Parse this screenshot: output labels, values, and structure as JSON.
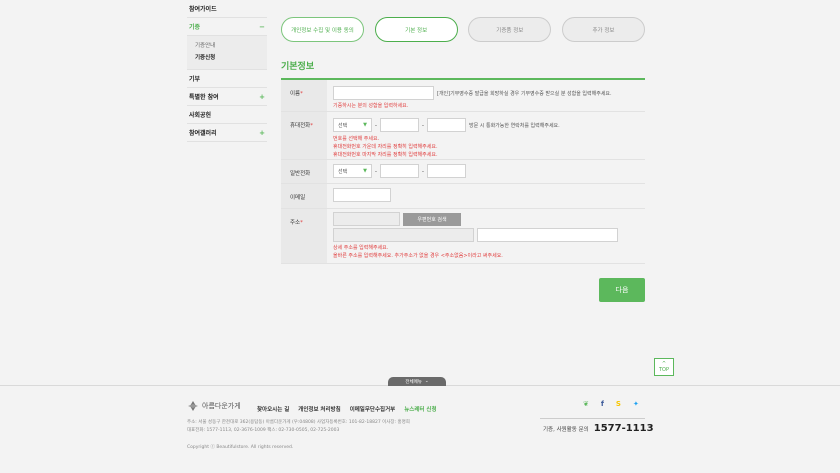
{
  "sidebar": {
    "items": [
      {
        "label": "참여가이드",
        "marker": ""
      },
      {
        "label": "기증",
        "marker": "−"
      },
      {
        "label": "기부",
        "marker": ""
      },
      {
        "label": "특별한 참여",
        "marker": "+"
      },
      {
        "label": "사회공헌",
        "marker": ""
      },
      {
        "label": "참여갤러리",
        "marker": "+"
      }
    ],
    "sub": [
      "기증안내",
      "기증신청"
    ]
  },
  "steps": [
    "개인정보 수집 및 이용 동의",
    "기본 정보",
    "기증품 정보",
    "추가 정보"
  ],
  "section_title": "기본정보",
  "form": {
    "name_label": "이름",
    "req": "*",
    "name_hint": "[개인]기부영수증 발급을 희망하실 경우 기부영수증 받으실 분 성함을 입력해주세요.",
    "name_error": "기증하시는 분의 성함을 입력하세요.",
    "mobile_label": "휴대전화",
    "select_default": "선택",
    "dash": "-",
    "mobile_hint": "방문 시 통화가능한 연락처를 입력해주세요.",
    "mobile_errors": [
      "번호를 선택해 주세요.",
      "휴대전화번호 가운데 자리를 정확히 입력해주세요.",
      "휴대전화번호 마지막 자리를 정확히 입력해주세요."
    ],
    "phone_label": "일반전화",
    "email_label": "이메일",
    "address_label": "주소",
    "zip_button": "우편번호 검색",
    "address_errors": [
      "상세 주소를 입력해주세요.",
      "올바른 주소를 입력해주세요. 추가주소가 없을 경우 <주소없음>이라고 써주세요."
    ]
  },
  "next_button": "다음",
  "top_button": "TOP",
  "all_menu": "전체메뉴",
  "footer": {
    "logo": "아름다운가게",
    "links": [
      "찾아오시는 길",
      "개인정보 처리방침",
      "이메일무단수집거부",
      "뉴스레터 신청"
    ],
    "address1": "주소: 서울 성동구 한천대로 362(용답동) 아름다운가게 (우:04808)   사업자등록번호: 101-82-18827   이사장: 홍명희",
    "address2": "대표전화: 1577-1113, 02-3676-1009   팩스: 02-730-0505, 02-725-2003",
    "copyright": "Copyright ⓒ Beautifulstore. All rights reserved.",
    "contact_label": "기증, 사원활동 문의",
    "contact_number": "1577-1113"
  },
  "colors": {
    "accent": "#5cb85c",
    "error": "#e03c3c"
  }
}
